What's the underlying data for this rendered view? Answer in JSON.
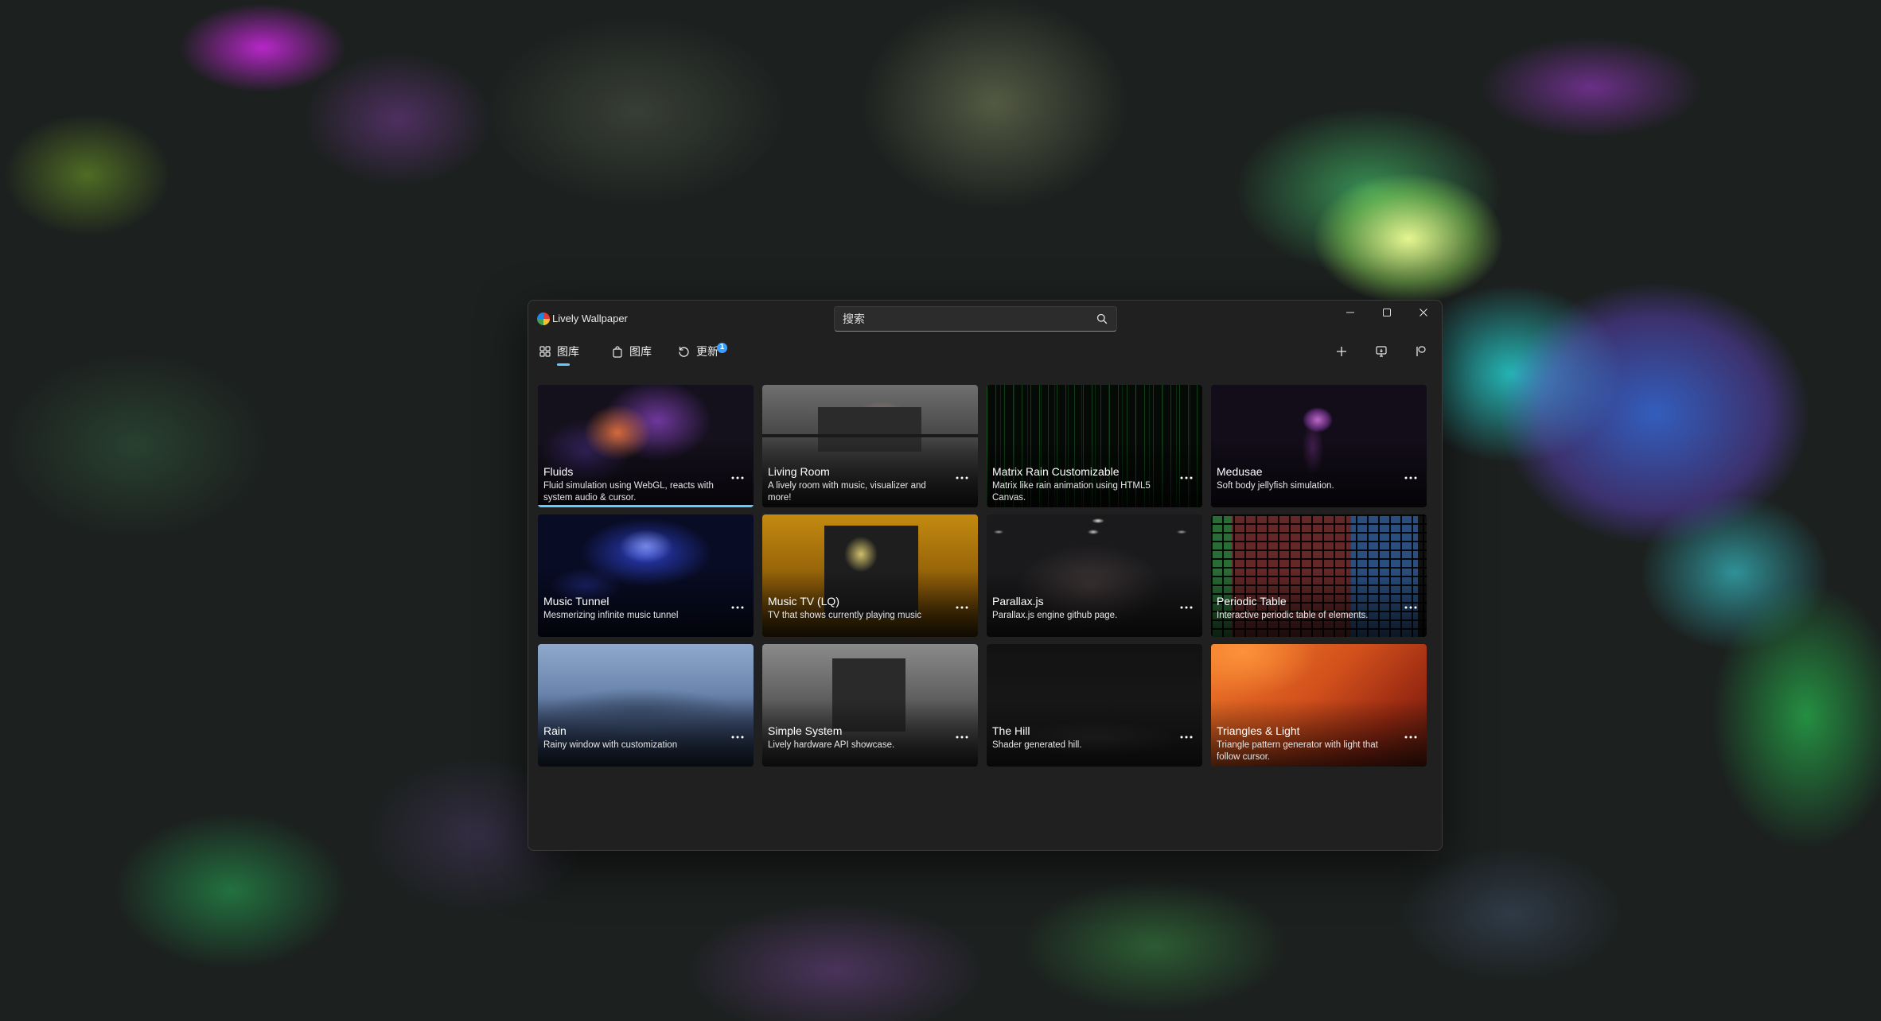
{
  "window": {
    "title": "Lively Wallpaper",
    "search": {
      "placeholder": "搜索"
    }
  },
  "toolbar": {
    "tabs": [
      {
        "label": "图库",
        "icon": "grid-icon",
        "active": true
      },
      {
        "label": "图库",
        "icon": "bag-icon",
        "active": false
      },
      {
        "label": "更新",
        "icon": "refresh-icon",
        "active": false,
        "badge": "1"
      }
    ],
    "actions": [
      "add-icon",
      "screen-icon",
      "toggle-icon",
      "settings-icon",
      "more-icon"
    ]
  },
  "accent": "#60cdff",
  "wallpapers": [
    {
      "title": "Fluids",
      "description": "Fluid simulation using WebGL, reacts with system audio & cursor.",
      "selected": true
    },
    {
      "title": "Living Room",
      "description": "A lively room with music, visualizer and more!"
    },
    {
      "title": "Matrix Rain Customizable",
      "description": "Matrix like rain animation using HTML5 Canvas."
    },
    {
      "title": "Medusae",
      "description": "Soft body jellyfish simulation."
    },
    {
      "title": "Music Tunnel",
      "description": "Mesmerizing infinite music tunnel"
    },
    {
      "title": "Music TV (LQ)",
      "description": "TV that shows currently playing music"
    },
    {
      "title": "Parallax.js",
      "description": "Parallax.js engine github page."
    },
    {
      "title": "Periodic Table",
      "description": "Interactive periodic table of elements."
    },
    {
      "title": "Rain",
      "description": "Rainy window with customization"
    },
    {
      "title": "Simple System",
      "description": "Lively hardware API showcase."
    },
    {
      "title": "The Hill",
      "description": "Shader generated hill."
    },
    {
      "title": "Triangles & Light",
      "description": "Triangle pattern generator with light that follow cursor."
    }
  ]
}
